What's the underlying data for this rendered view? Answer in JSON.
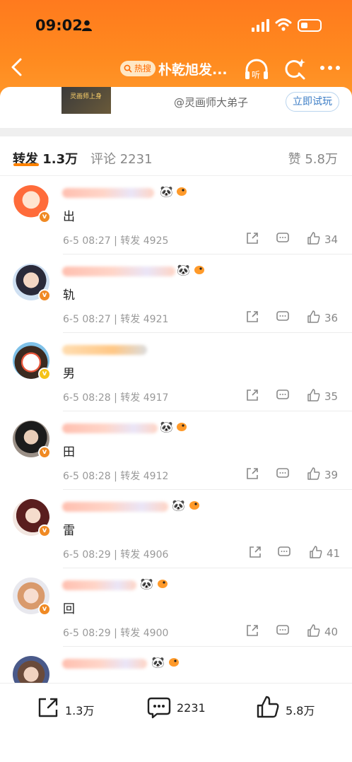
{
  "status_bar": {
    "time": "09:02"
  },
  "nav": {
    "hot_tag": "热搜",
    "title": "朴乾旭发..."
  },
  "card": {
    "thumb_caption": "灵画师上身",
    "author": "@灵画师大弟子",
    "try_button": "立即试玩"
  },
  "tabs": {
    "repost_label": "转发",
    "repost_count": "1.3万",
    "comments_label": "评论",
    "comments_count": "2231",
    "likes_label": "赞",
    "likes_count": "5.8万"
  },
  "accent_color": "#ff8200",
  "reposts": [
    {
      "text": "出",
      "time": "6-5 08:27",
      "repost_label": "转发",
      "repost_count": "4925",
      "likes": "34",
      "badge_color": "#f08a24"
    },
    {
      "text": "轨",
      "time": "6-5 08:27",
      "repost_label": "转发",
      "repost_count": "4921",
      "likes": "36",
      "badge_color": "#f08a24"
    },
    {
      "text": "男",
      "time": "6-5 08:28",
      "repost_label": "转发",
      "repost_count": "4917",
      "likes": "35",
      "badge_color": "#f5c317"
    },
    {
      "text": "田",
      "time": "6-5 08:28",
      "repost_label": "转发",
      "repost_count": "4912",
      "likes": "39",
      "badge_color": "#f08a24"
    },
    {
      "text": "雷",
      "time": "6-5 08:29",
      "repost_label": "转发",
      "repost_count": "4906",
      "likes": "41",
      "badge_color": "#f08a24"
    },
    {
      "text": "回",
      "time": "6-5 08:29",
      "repost_label": "转发",
      "repost_count": "4900",
      "likes": "40",
      "badge_color": "#f08a24"
    }
  ],
  "bottom_bar": {
    "repost_count": "1.3万",
    "comment_count": "2231",
    "like_count": "5.8万"
  }
}
